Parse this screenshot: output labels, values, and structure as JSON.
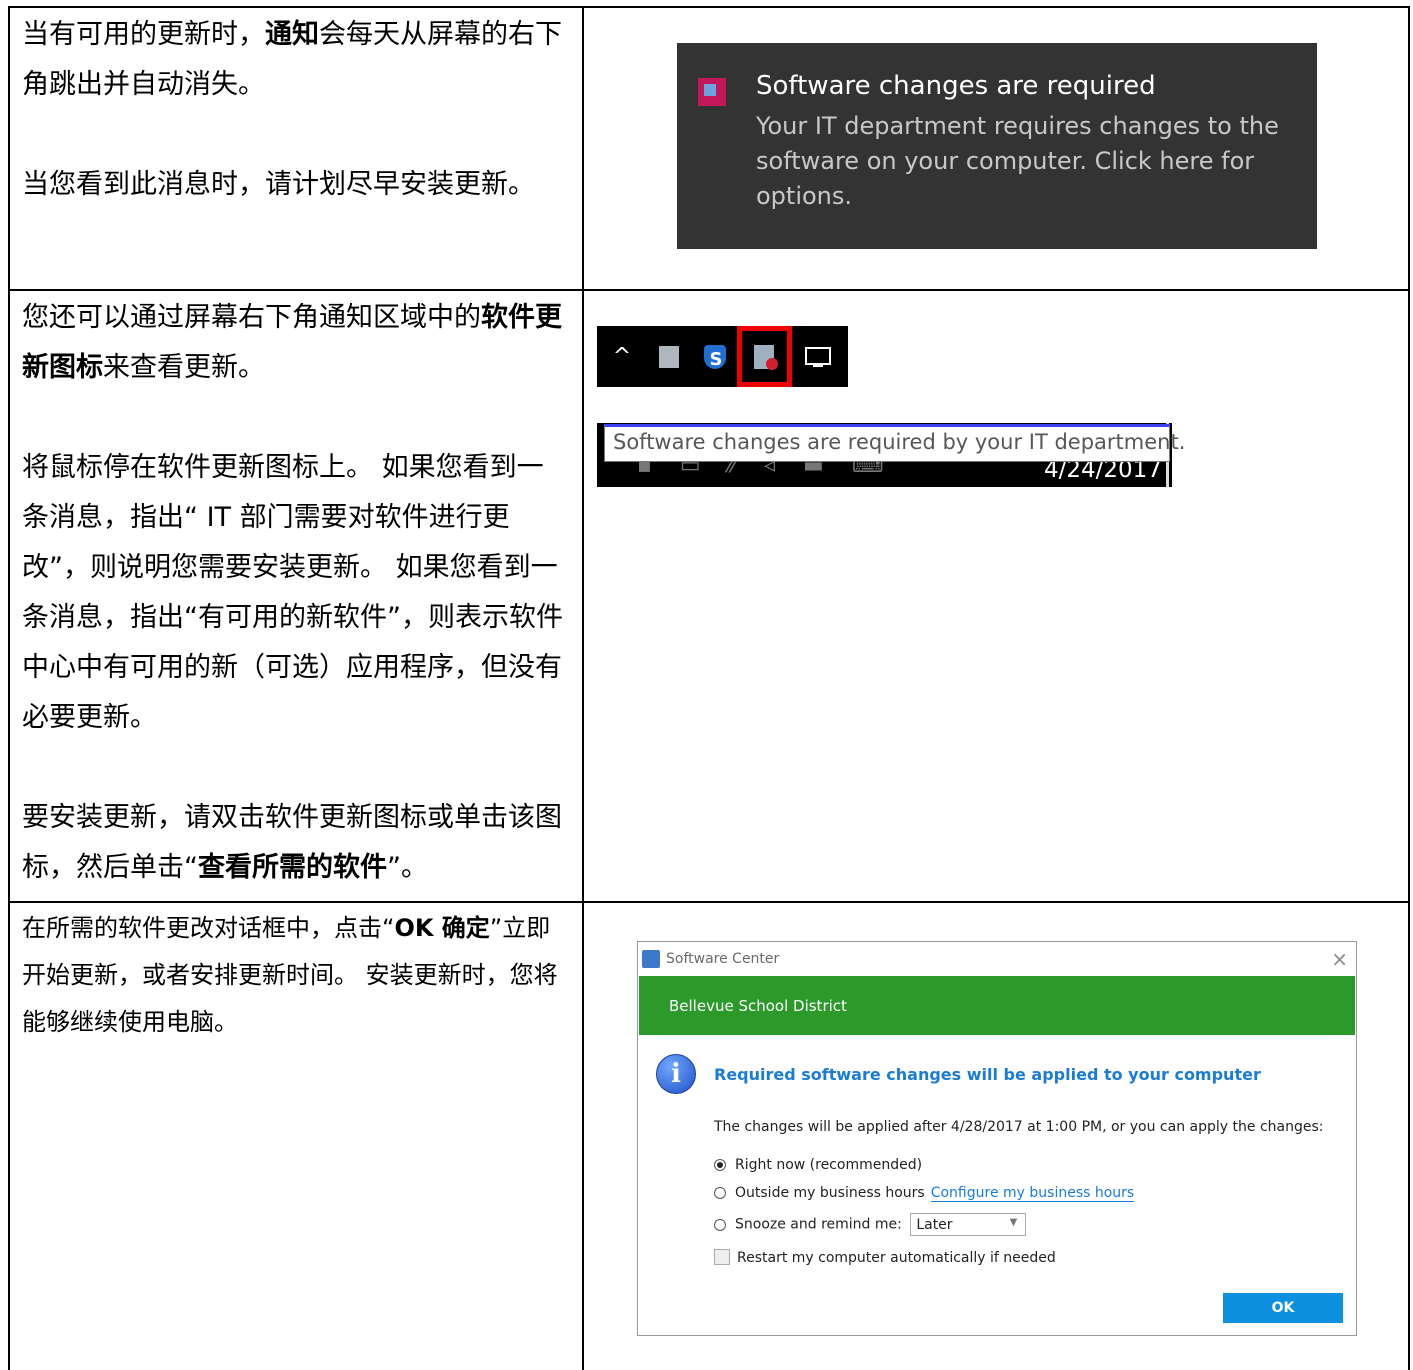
{
  "rows": [
    {
      "paragraphs": [
        {
          "parts": [
            {
              "t": "当有可用的更新时，",
              "b": false
            },
            {
              "t": "通知",
              "b": true
            },
            {
              "t": "会每天从屏幕的右下角跳出并自动消失。",
              "b": false
            }
          ]
        },
        {
          "parts": [
            {
              "t": "当您看到此消息时，请计划尽早安装更新。",
              "b": false
            }
          ]
        }
      ]
    },
    {
      "paragraphs": [
        {
          "parts": [
            {
              "t": "您还可以通过屏幕右下角通知区域中的",
              "b": false
            },
            {
              "t": "软件更新图标",
              "b": true
            },
            {
              "t": "来查看更新。",
              "b": false
            }
          ]
        },
        {
          "parts": [
            {
              "t": "将鼠标停在软件更新图标上。 如果您看到一条消息，指出“ IT 部门需要对软件进行更改”，则说明您需要安装更新。 如果您看到一条消息，指出“有可用的新软件”，则表示软件中心中有可用的新（可选）应用程序，但没有必要更新。",
              "b": false
            }
          ]
        },
        {
          "parts": [
            {
              "t": "要安装更新，请双击软件更新图标或单击该图标，然后单击“",
              "b": false
            },
            {
              "t": "查看所需的软件",
              "b": true
            },
            {
              "t": "”。",
              "b": false
            }
          ]
        }
      ]
    },
    {
      "paragraphs": [
        {
          "parts": [
            {
              "t": "在所需的软件更改对话框中，点击“",
              "b": false
            },
            {
              "t": "OK 确定",
              "b": true
            },
            {
              "t": "”立即开始更新，或者安排更新时间。 安装更新时，您将能够继续使用电脑。",
              "b": false
            }
          ]
        }
      ]
    }
  ],
  "toast": {
    "title": "Software changes are required",
    "body": "Your IT department requires changes to the software on your computer. Click here for options."
  },
  "tray": {
    "chevron": "^",
    "icons": [
      "chevron-up-icon",
      "magnifier-icon",
      "shield-s-icon",
      "software-center-icon",
      "network-icon"
    ],
    "shield_letter": "S"
  },
  "tooltip": {
    "text": "Software changes are required by your IT department.",
    "date": "4/24/2017"
  },
  "dialog": {
    "title": "Software Center",
    "org": "Bellevue School District",
    "heading": "Required software changes will be applied to your computer",
    "description": "The changes will be applied after 4/28/2017 at 1:00 PM, or you can apply the changes:",
    "options": [
      {
        "label": "Right now (recommended)",
        "selected": true
      },
      {
        "label": "Outside my business hours",
        "selected": false,
        "link": "Configure my business hours"
      },
      {
        "label": "Snooze and remind me:",
        "selected": false,
        "select_value": "Later"
      }
    ],
    "checkbox": "Restart my computer automatically if needed",
    "ok": "OK",
    "close": "×",
    "info_glyph": "i"
  },
  "colors": {
    "toast_bg": "#333333",
    "dialog_header": "#2b9a2b",
    "ok_button": "#0e90e0",
    "highlight_box": "#ee0000",
    "link": "#1a7cd6"
  }
}
